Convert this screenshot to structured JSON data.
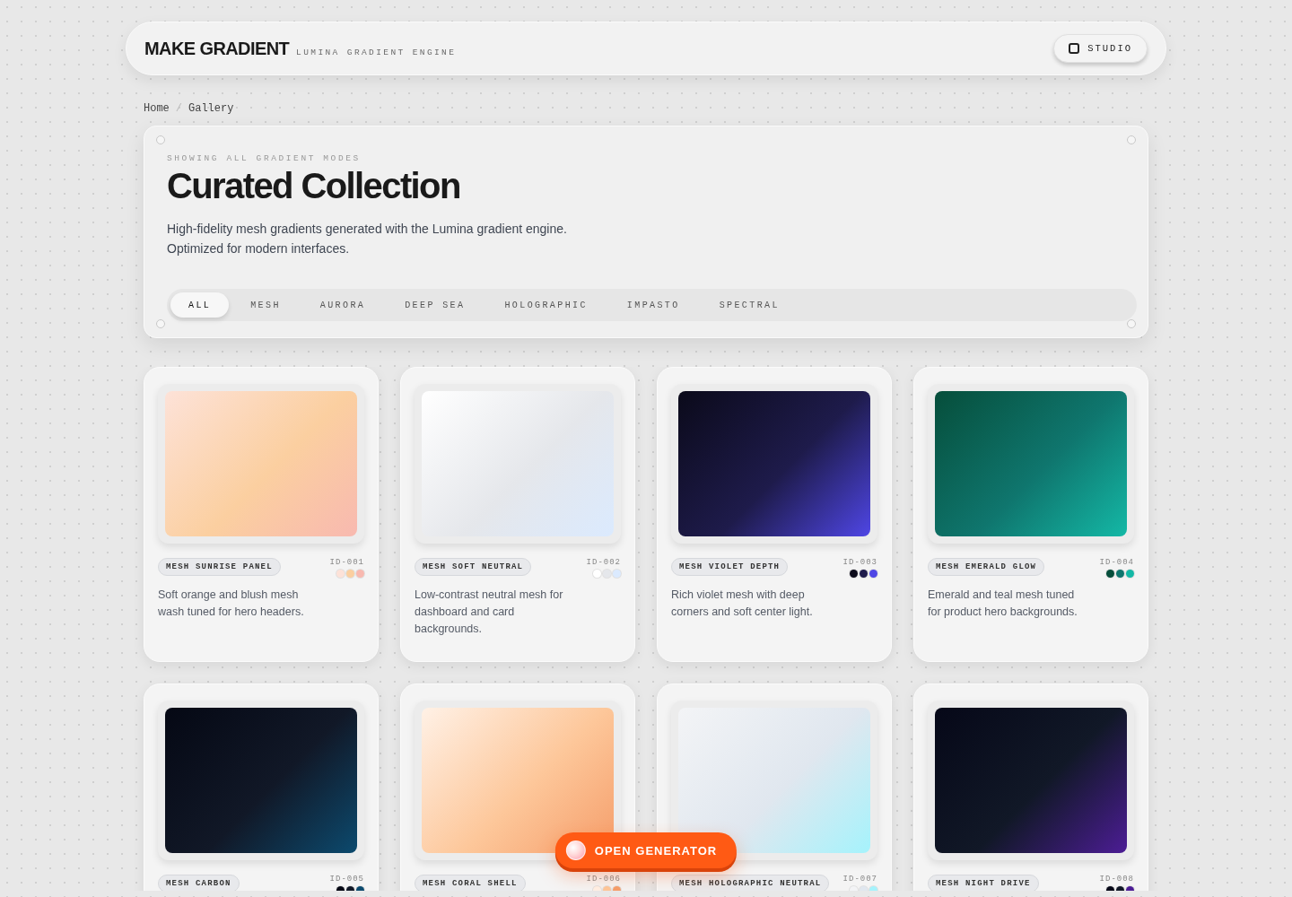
{
  "header": {
    "logo": "MAKE GRADIENT",
    "tagline": "LUMINA GRADIENT ENGINE",
    "studio_button": "STUDIO"
  },
  "breadcrumb": [
    "Home",
    "Gallery"
  ],
  "breadcrumb_separator": "/",
  "hero": {
    "eyebrow": "SHOWING ALL GRADIENT MODES",
    "title": "Curated Collection",
    "description": [
      "High-fidelity mesh gradients generated with the Lumina gradient engine.",
      "Optimized for modern interfaces."
    ]
  },
  "filters": [
    {
      "label": "ALL",
      "selected": true
    },
    {
      "label": "MESH",
      "selected": false
    },
    {
      "label": "AURORA",
      "selected": false
    },
    {
      "label": "DEEP SEA",
      "selected": false
    },
    {
      "label": "HOLOGRAPHIC",
      "selected": false
    },
    {
      "label": "IMPASTO",
      "selected": false
    },
    {
      "label": "SPECTRAL",
      "selected": false
    }
  ],
  "cards": [
    {
      "name": "MESH SUNRISE PANEL",
      "id": "ID-001",
      "description": "Soft orange and blush mesh wash tuned for hero headers.",
      "swatches": [
        {
          "color": "#fde2d8"
        },
        {
          "color": "#fbcfa0"
        },
        {
          "color": "#f8b9b0"
        }
      ]
    },
    {
      "name": "MESH SOFT NEUTRAL",
      "id": "ID-002",
      "description": "Low-contrast neutral mesh for dashboard and card backgrounds.",
      "swatches": [
        {
          "color": "#ffffff"
        },
        {
          "color": "#e5e7eb"
        },
        {
          "color": "#dbeafe"
        }
      ]
    },
    {
      "name": "MESH VIOLET DEPTH",
      "id": "ID-003",
      "description": "Rich violet mesh with deep corners and soft center light.",
      "swatches": [
        {
          "color": "#0b0a1a"
        },
        {
          "color": "#1e1b4b"
        },
        {
          "color": "#4f46e5"
        }
      ]
    },
    {
      "name": "MESH EMERALD GLOW",
      "id": "ID-004",
      "description": "Emerald and teal mesh tuned for product hero backgrounds.",
      "swatches": [
        {
          "color": "#064e3b"
        },
        {
          "color": "#0f766e"
        },
        {
          "color": "#14b8a6"
        }
      ]
    },
    {
      "name": "MESH CARBON",
      "id": "ID-005",
      "swatches": [
        {
          "color": "#050814"
        },
        {
          "color": "#111827"
        },
        {
          "color": "#0c4a6e"
        }
      ]
    },
    {
      "name": "MESH CORAL SHELL",
      "id": "ID-006",
      "swatches": [
        {
          "color": "#fff1e6"
        },
        {
          "color": "#fdc79a"
        },
        {
          "color": "#f59e6b"
        }
      ]
    },
    {
      "name": "MESH HOLOGRAPHIC NEUTRAL",
      "id": "ID-007",
      "swatches": [
        {
          "color": "#f3f4f6"
        },
        {
          "color": "#e0e7ef"
        },
        {
          "color": "#a5f3fc"
        }
      ]
    },
    {
      "name": "MESH NIGHT DRIVE",
      "id": "ID-008",
      "swatches": [
        {
          "color": "#060818"
        },
        {
          "color": "#111827"
        },
        {
          "color": "#4c1d95"
        }
      ]
    }
  ],
  "fab": {
    "label": "OPEN GENERATOR"
  }
}
